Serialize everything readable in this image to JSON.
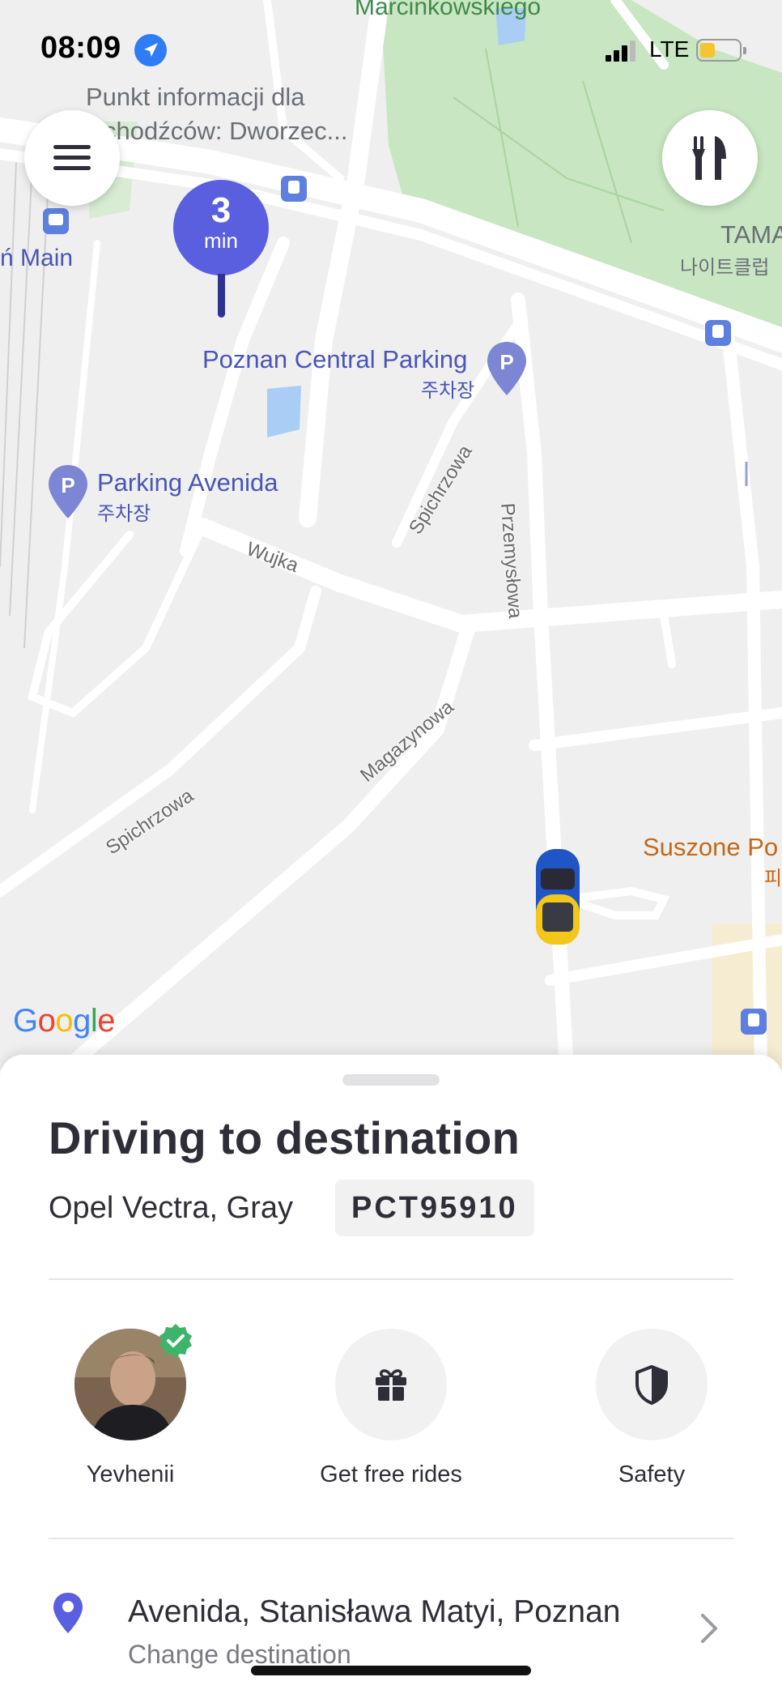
{
  "status_bar": {
    "time": "08:09",
    "network": "LTE",
    "battery_level": 0.4,
    "battery_color": "#f5c431"
  },
  "map": {
    "labels": {
      "top_park": "Marcinkowskiego",
      "info_point_1": "Punkt informacji dla",
      "info_point_2": "chodźców: Dworzec...",
      "main_station": "ń Main",
      "central_parking": "Poznan Central Parking",
      "central_parking_ko": "주차장",
      "parking_avenida": "Parking Avenida",
      "parking_avenida_ko": "주차장",
      "tama": "TAMA",
      "tama_ko": "나이트클럽",
      "suszone": "Suszone Po",
      "suszone_ko": "피",
      "street_wujka": "Wujka",
      "street_spichrzowa_1": "Spichrzowa",
      "street_spichrzowa_2": "Spichrzowa",
      "street_przemyslowa": "Przemysłowa",
      "street_magazynowa": "Magazynowa",
      "parking_letter": "P"
    },
    "eta": {
      "value": "3",
      "unit": "min"
    },
    "accent_color": "#5a5fe0",
    "park_color": "#c8e6c1",
    "google_logo": [
      "G",
      "o",
      "o",
      "g",
      "l",
      "e"
    ]
  },
  "trip": {
    "status": "Driving to destination",
    "car": "Opel Vectra, Gray",
    "plate": "PCT95910"
  },
  "actions": [
    {
      "label": "Yevhenii",
      "icon": "driver-avatar"
    },
    {
      "label": "Get free rides",
      "icon": "gift-icon"
    },
    {
      "label": "Safety",
      "icon": "shield-icon"
    }
  ],
  "destination": {
    "address": "Avenida, Stanisława Matyi, Poznan",
    "change_label": "Change destination"
  }
}
